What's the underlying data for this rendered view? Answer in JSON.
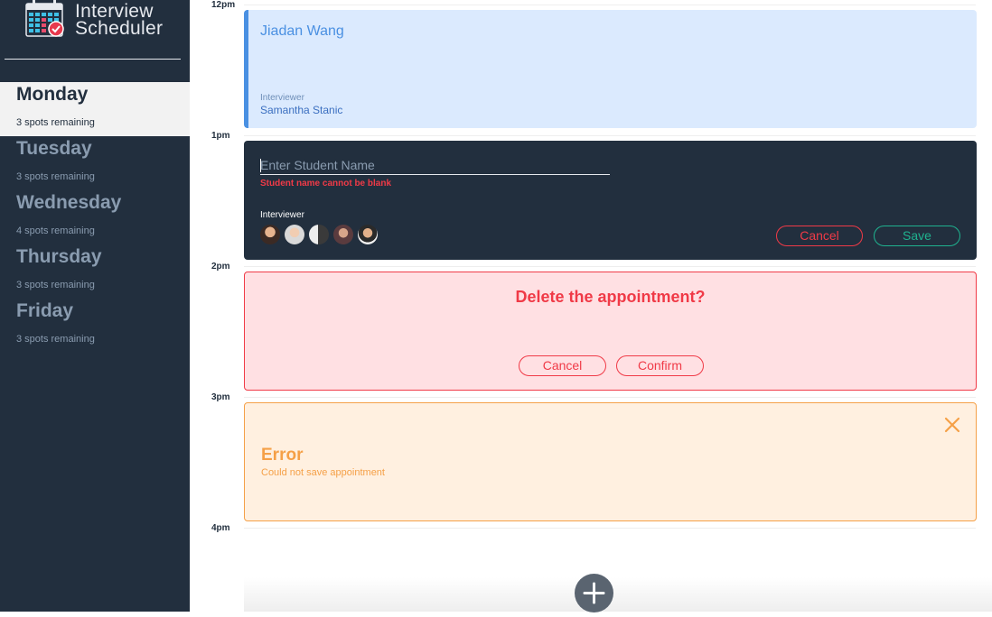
{
  "app": {
    "title_line1": "Interview",
    "title_line2": "Scheduler"
  },
  "days": [
    {
      "name": "Monday",
      "spots": "3 spots remaining",
      "selected": true
    },
    {
      "name": "Tuesday",
      "spots": "3 spots remaining"
    },
    {
      "name": "Wednesday",
      "spots": "4 spots remaining"
    },
    {
      "name": "Thursday",
      "spots": "3 spots remaining"
    },
    {
      "name": "Friday",
      "spots": "3 spots remaining"
    }
  ],
  "times": [
    "12pm",
    "1pm",
    "2pm",
    "3pm",
    "4pm"
  ],
  "appointment_show": {
    "student": "Jiadan Wang",
    "interviewer_label": "Interviewer",
    "interviewer_name": "Samantha Stanic"
  },
  "appointment_form": {
    "placeholder": "Enter Student Name",
    "error": "Student name cannot be blank",
    "interviewer_label": "Interviewer",
    "cancel_label": "Cancel",
    "save_label": "Save"
  },
  "appointment_confirm": {
    "message": "Delete the appointment?",
    "cancel_label": "Cancel",
    "confirm_label": "Confirm"
  },
  "appointment_error": {
    "title": "Error",
    "message": "Could not save appointment"
  },
  "icons": {
    "logo": "calendar-check-icon",
    "close": "close-icon",
    "add": "plus-icon"
  },
  "colors": {
    "sidebar": "#222f3e",
    "accent_blue": "#4a90e2",
    "danger": "#f03a47",
    "success": "#1fb28f",
    "warning": "#f5a047"
  }
}
